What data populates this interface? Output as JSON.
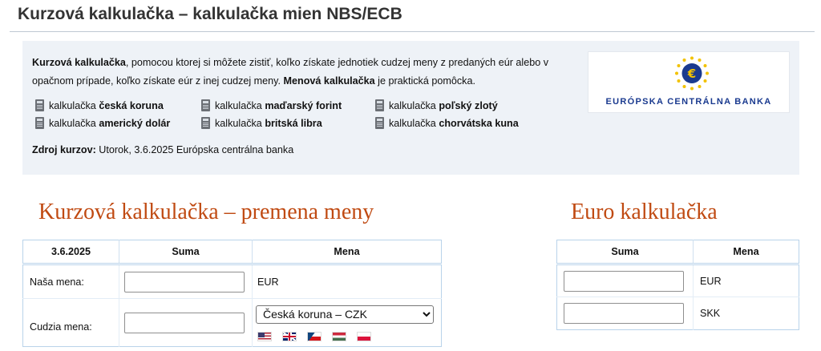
{
  "page": {
    "title": "Kurzová kalkulačka – kalkulačka mien NBS/ECB"
  },
  "intro": {
    "bold1": "Kurzová kalkulačka",
    "text1": ", pomocou ktorej si môžete zistiť, koľko získate jednotiek cudzej meny z predaných eúr alebo v opačnom prípade, koľko získate eúr z inej cudzej meny. ",
    "bold2": "Menová kalkulačka",
    "text2": " je praktická pomôcka."
  },
  "calculators": [
    {
      "prefix": "kalkulačka",
      "currency": "česká koruna"
    },
    {
      "prefix": "kalkulačka",
      "currency": "maďarský forint"
    },
    {
      "prefix": "kalkulačka",
      "currency": "poľský zlotý"
    },
    {
      "prefix": "kalkulačka",
      "currency": "americký dolár"
    },
    {
      "prefix": "kalkulačka",
      "currency": "britská libra"
    },
    {
      "prefix": "kalkulačka",
      "currency": "chorvátska kuna"
    }
  ],
  "source": {
    "label": "Zdroj kurzov:",
    "value": " Utorok, 3.6.2025 Európska centrálna banka"
  },
  "ecb": {
    "name": "EURÓPSKA CENTRÁLNA BANKA",
    "colors": {
      "text": "#1a3a8f",
      "circle": "#1a3a8f",
      "stars": "#f2c200"
    }
  },
  "exchange_calc": {
    "title": "Kurzová kalkulačka – premena meny",
    "headers": {
      "date": "3.6.2025",
      "amount": "Suma",
      "currency": "Mena"
    },
    "rows": [
      {
        "label": "Naša mena:",
        "value": "",
        "currency": "EUR"
      },
      {
        "label": "Cudzia mena:",
        "value": ""
      }
    ],
    "selected_currency": "Česká koruna – CZK",
    "flags": [
      "us-flag",
      "uk-flag",
      "czech-flag",
      "hungarian-flag",
      "polish-flag"
    ]
  },
  "euro_calc": {
    "title": "Euro kalkulačka",
    "headers": {
      "amount": "Suma",
      "currency": "Mena"
    },
    "rows": [
      {
        "value": "",
        "currency": "EUR"
      },
      {
        "value": "",
        "currency": "SKK"
      }
    ]
  },
  "colors": {
    "section_title": "#c04a12",
    "info_bg": "#eef2f7",
    "table_border": "#b9d3ea"
  }
}
